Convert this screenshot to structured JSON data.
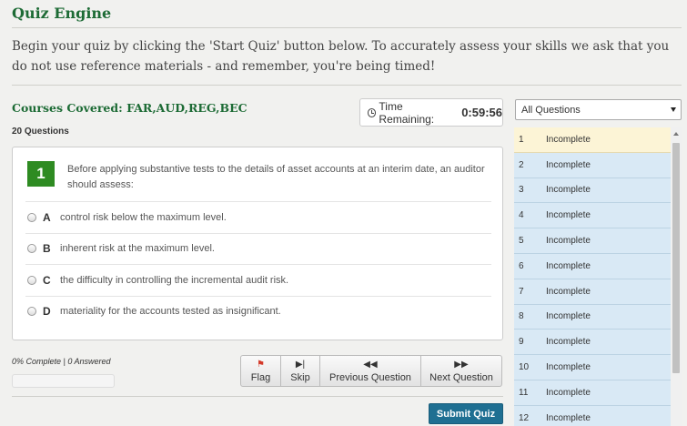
{
  "header": {
    "title": "Quiz Engine",
    "intro": "Begin your quiz by clicking the 'Start Quiz' button below. To accurately assess your skills we ask that you do not use reference materials - and remember, you're being timed!"
  },
  "quiz": {
    "courses": "Courses Covered: FAR,AUD,REG,BEC",
    "question_count": "20 Questions",
    "timer_label": "Time Remaining:",
    "timer_value": "0:59:56"
  },
  "question": {
    "number": "1",
    "text": "Before applying substantive tests to the details of asset accounts at an interim date, an auditor should assess:",
    "options": [
      {
        "letter": "A",
        "text": "control risk below the maximum level."
      },
      {
        "letter": "B",
        "text": "inherent risk at the maximum level."
      },
      {
        "letter": "C",
        "text": "the difficulty in controlling the incremental audit risk."
      },
      {
        "letter": "D",
        "text": "materiality for the accounts tested as insignificant."
      }
    ]
  },
  "progress": {
    "label": "0% Complete | 0 Answered",
    "fraction": 0.0
  },
  "nav": {
    "flag": "Flag",
    "skip": "Skip",
    "previous": "Previous Question",
    "next": "Next Question",
    "icons": {
      "flag": "flag-icon",
      "skip": "skip-forward-icon",
      "previous": "rewind-icon",
      "next": "fast-forward-icon"
    }
  },
  "submit_label": "Submit Quiz",
  "sidebar": {
    "filter_selected": "All Questions",
    "items": [
      {
        "num": "1",
        "status": "Incomplete"
      },
      {
        "num": "2",
        "status": "Incomplete"
      },
      {
        "num": "3",
        "status": "Incomplete"
      },
      {
        "num": "4",
        "status": "Incomplete"
      },
      {
        "num": "5",
        "status": "Incomplete"
      },
      {
        "num": "6",
        "status": "Incomplete"
      },
      {
        "num": "7",
        "status": "Incomplete"
      },
      {
        "num": "8",
        "status": "Incomplete"
      },
      {
        "num": "9",
        "status": "Incomplete"
      },
      {
        "num": "10",
        "status": "Incomplete"
      },
      {
        "num": "11",
        "status": "Incomplete"
      },
      {
        "num": "12",
        "status": "Incomplete"
      }
    ]
  },
  "colors": {
    "brand_green": "#1d6b35",
    "question_badge": "#2e8b22",
    "submit_blue": "#1f6f92",
    "list_item": "#d9e9f5",
    "list_active": "#fcf4d6"
  }
}
